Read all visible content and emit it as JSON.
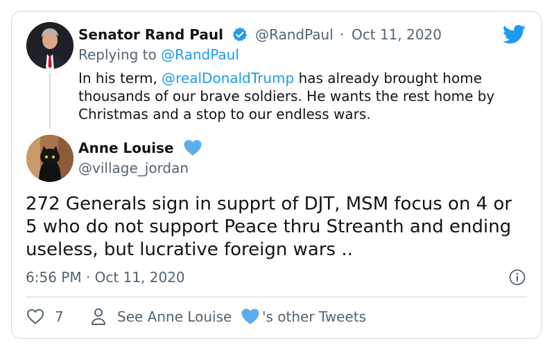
{
  "parent_tweet": {
    "author_name": "Senator Rand Paul",
    "verified_icon": "verified-badge-icon",
    "handle": "@RandPaul",
    "separator": "·",
    "date": "Oct 11, 2020",
    "replying_prefix": "Replying to",
    "replying_handle": "@RandPaul",
    "text_before_mention": "In his term, ",
    "mention": "@realDonaldTrump",
    "text_line1_after": " has already brought home",
    "text_line2": "thousands of our brave soldiers. He wants the rest home by",
    "text_line3": "Christmas and a stop to our endless wars."
  },
  "tweet": {
    "author_name": "Anne Louise",
    "author_emoji_icon": "blue-heart-icon",
    "handle": "@village_jordan",
    "text_line1": "272 Generals sign in supprt of DJT, MSM focus on 4 or",
    "text_line2": "5 who do not support Peace thru Streanth and ending",
    "text_line3": "useless, but lucrative foreign wars ..",
    "timestamp": "6:56 PM · Oct 11, 2020",
    "info_icon": "info-icon"
  },
  "actions": {
    "like_icon": "heart-outline-icon",
    "like_count": "7",
    "profile_icon": "person-outline-icon",
    "see_prefix": "See Anne Louise",
    "see_suffix": "'s other Tweets"
  },
  "brand": {
    "logo_icon": "twitter-bird-icon",
    "accent_color": "#1d9bf0",
    "heart_color": "#5dadec"
  }
}
